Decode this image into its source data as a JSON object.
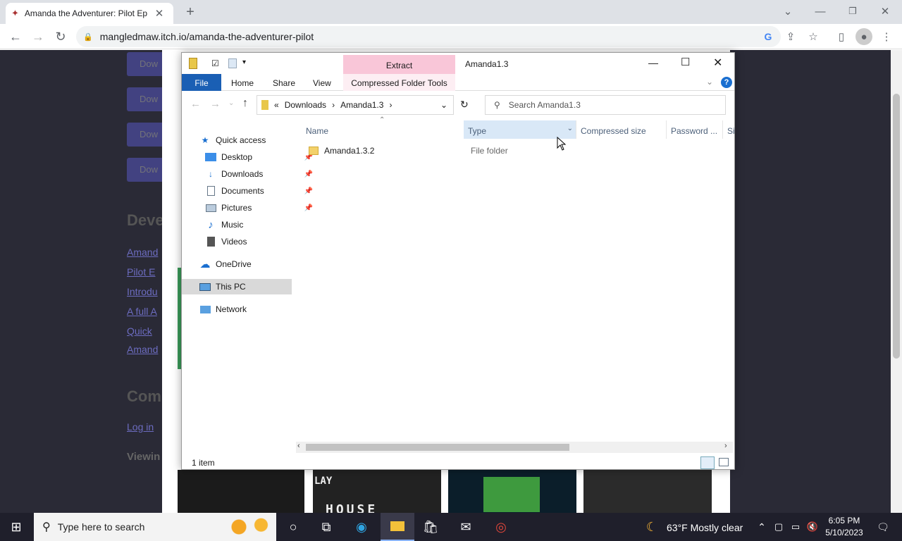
{
  "browser": {
    "tab_title": "Amanda the Adventurer: Pilot Ep",
    "url": "mangledmaw.itch.io/amanda-the-adventurer-pilot"
  },
  "page": {
    "download_label": "Dow",
    "heading_dev": "Deve",
    "heading_comments": "Com",
    "login_link": "Log in",
    "viewing": "Viewin",
    "links": [
      "Amand",
      "Pilot E",
      "Introdu",
      "A full A",
      "Quick",
      "Amand"
    ],
    "thumb_text1": "LAY",
    "thumb_text2": "HOUSE"
  },
  "explorer": {
    "window_title": "Amanda1.3",
    "extract_tab": "Extract",
    "ribbon_tabs": [
      "File",
      "Home",
      "Share",
      "View",
      "Compressed Folder Tools"
    ],
    "breadcrumb": [
      "Downloads",
      "Amanda1.3"
    ],
    "breadcrumb_prefix": "«",
    "search_placeholder": "Search Amanda1.3",
    "nav": {
      "quick_access": "Quick access",
      "desktop": "Desktop",
      "downloads": "Downloads",
      "documents": "Documents",
      "pictures": "Pictures",
      "music": "Music",
      "videos": "Videos",
      "onedrive": "OneDrive",
      "this_pc": "This PC",
      "network": "Network"
    },
    "columns": [
      "Name",
      "Type",
      "Compressed size",
      "Password ...",
      "Si"
    ],
    "rows": [
      {
        "name": "Amanda1.3.2",
        "type": "File folder"
      }
    ],
    "status": "1 item"
  },
  "taskbar": {
    "search_placeholder": "Type here to search",
    "weather": "63°F  Mostly clear",
    "time": "6:05 PM",
    "date": "5/10/2023"
  },
  "colors": {
    "accent": "#1a5fb4",
    "extract_tab": "#f9c6d8",
    "selected_nav": "#d9d9d9"
  }
}
